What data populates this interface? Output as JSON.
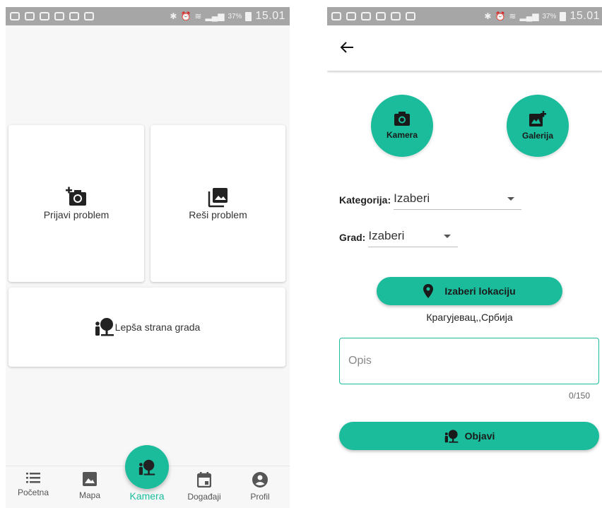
{
  "status_bar": {
    "battery_percent": "37%",
    "time": "15.01"
  },
  "left_screen": {
    "tiles": {
      "report": {
        "label": "Prijavi problem",
        "icon": "add-a-photo-icon"
      },
      "solve": {
        "label": "Reši problem",
        "icon": "photo-library-icon"
      },
      "bright_side": {
        "label": "Lepša strana grada",
        "icon": "person-tree-icon"
      }
    },
    "bottom_nav": {
      "items": [
        {
          "label": "Početna",
          "icon": "list-icon"
        },
        {
          "label": "Mapa",
          "icon": "image-icon"
        },
        {
          "label": "Kamera",
          "icon": "person-tree-icon",
          "active": true
        },
        {
          "label": "Događaji",
          "icon": "calendar-icon"
        },
        {
          "label": "Profil",
          "icon": "account-circle-icon"
        }
      ]
    }
  },
  "right_screen": {
    "camera_button": {
      "label": "Kamera",
      "icon": "camera-icon"
    },
    "gallery_button": {
      "label": "Galerija",
      "icon": "add-photo-icon"
    },
    "category": {
      "label": "Kategorija:",
      "value": "Izaberi"
    },
    "city": {
      "label": "Grad:",
      "value": "Izaberi"
    },
    "location_button": {
      "label": "Izaberi lokaciju",
      "icon": "location-pin-icon"
    },
    "location_text": "Крагујевац,,Србија",
    "description": {
      "placeholder": "Opis",
      "value": ""
    },
    "char_count": "0/150",
    "publish_button": {
      "label": "Objavi",
      "icon": "person-tree-icon"
    }
  },
  "colors": {
    "accent": "#1abc9c",
    "status_bar": "#a6a6a6",
    "background": "#f7f7f7"
  }
}
